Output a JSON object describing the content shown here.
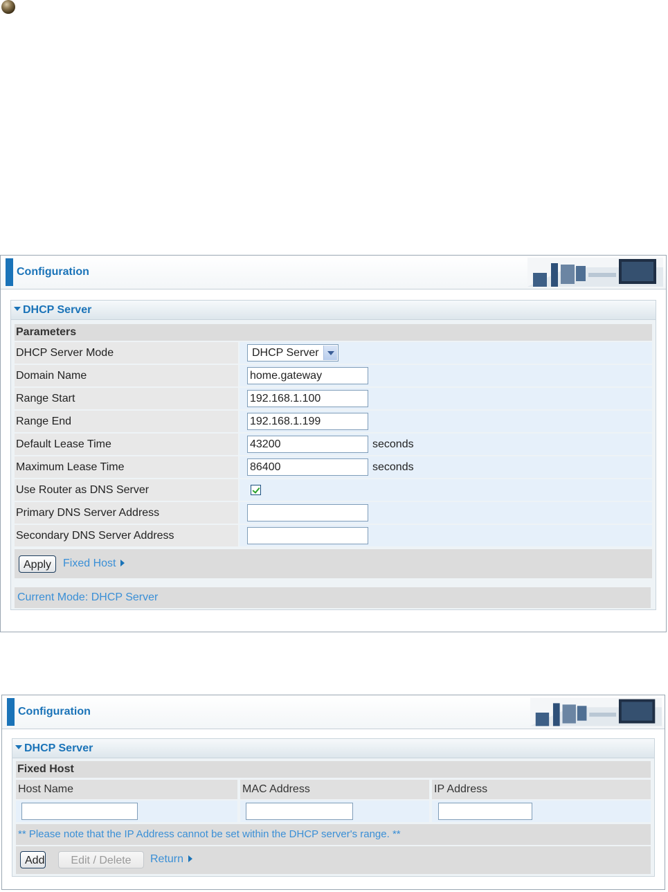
{
  "panels": [
    {
      "header_title": "Configuration",
      "section_title": "DHCP Server",
      "parameters_label": "Parameters",
      "fields": {
        "dhcp_mode": {
          "label": "DHCP Server Mode",
          "value": "DHCP Server"
        },
        "domain_name": {
          "label": "Domain Name",
          "value": "home.gateway"
        },
        "range_start": {
          "label": "Range Start",
          "value": "192.168.1.100"
        },
        "range_end": {
          "label": "Range End",
          "value": "192.168.1.199"
        },
        "default_lease": {
          "label": "Default Lease Time",
          "value": "43200",
          "unit": "seconds"
        },
        "max_lease": {
          "label": "Maximum Lease Time",
          "value": "86400",
          "unit": "seconds"
        },
        "use_router_dns": {
          "label": "Use Router as DNS Server",
          "checked": true
        },
        "primary_dns": {
          "label": "Primary DNS Server Address",
          "value": ""
        },
        "secondary_dns": {
          "label": "Secondary DNS Server Address",
          "value": ""
        }
      },
      "apply_label": "Apply",
      "fixed_host_link": "Fixed Host",
      "current_mode": "Current Mode: DHCP Server"
    },
    {
      "header_title": "Configuration",
      "section_title": "DHCP Server",
      "fixed_host_label": "Fixed Host",
      "columns": [
        "Host Name",
        "MAC Address",
        "IP Address"
      ],
      "inputs": {
        "host_name": "",
        "mac_address": "",
        "ip_address": ""
      },
      "note": "** Please note that the IP Address cannot be set within the DHCP server's range. **",
      "add_label": "Add",
      "edit_delete_label": "Edit / Delete",
      "return_link": "Return"
    }
  ],
  "colors": {
    "accent": "#1a73b8",
    "link": "#3a8fd6",
    "row_value_bg": "#e6f0fa",
    "label_bg": "#e8e8e8"
  }
}
